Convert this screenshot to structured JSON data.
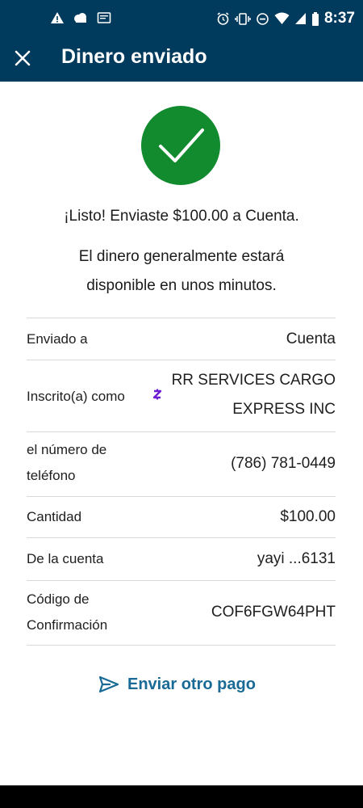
{
  "status_bar": {
    "time": "8:37"
  },
  "header": {
    "title": "Dinero enviado"
  },
  "confirmation": {
    "headline": "¡Listo! Enviaste $100.00 a Cuenta.",
    "subtext": "El dinero generalmente estará disponible en unos minutos."
  },
  "details": {
    "sent_to_label": "Enviado a",
    "sent_to_value": "Cuenta",
    "enrolled_label": "Inscrito(a) como",
    "enrolled_value_line1": "RR SERVICES CARGO",
    "enrolled_value_line2": "EXPRESS INC",
    "phone_label_line1": "el número de",
    "phone_label_line2": "teléfono",
    "phone_value": "(786) 781-0449",
    "amount_label": "Cantidad",
    "amount_value": "$100.00",
    "account_label": "De la cuenta",
    "account_value": "yayi ...6131",
    "code_label_line1": "Código de",
    "code_label_line2": "Confirmación",
    "code_value": "COF6FGW64PHT"
  },
  "actions": {
    "send_again_label": "Enviar otro pago"
  },
  "colors": {
    "header_bg": "#003a5c",
    "success_green": "#128a2e",
    "link_blue": "#1a6a96",
    "zelle_purple": "#6d1ed4"
  },
  "icons": [
    "warning-icon",
    "cloud-icon",
    "message-icon",
    "alarm-icon",
    "vibrate-icon",
    "do-not-disturb-icon",
    "wifi-icon",
    "signal-icon",
    "battery-icon",
    "close-icon",
    "checkmark-icon",
    "zelle-icon",
    "send-icon"
  ]
}
